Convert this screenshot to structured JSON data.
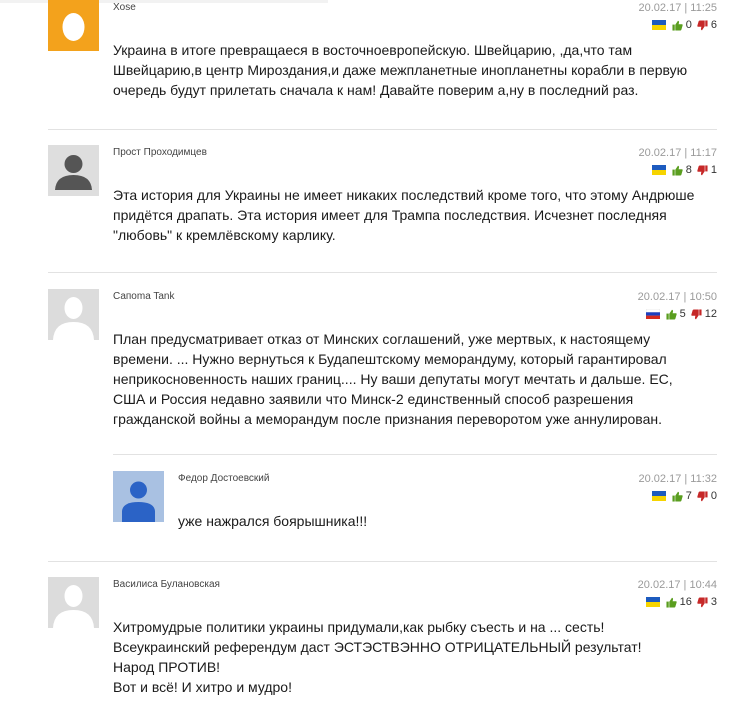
{
  "comments": [
    {
      "author": "Xose",
      "date": "20.02.17 | 11:25",
      "flag": "ukraine-flag",
      "avatar": "egg-avatar",
      "likes": "0",
      "dislikes": "6",
      "text": "Украина в итоге превращаеся в восточноевропейскую. Швейцарию, ,да,что там\nШвейцарию,в центр Мироздания,и даже межпланетные инопланетны корабли в первую\nочередь будут прилетать сначала к нам! Давайте поверим а,ну в последний раз."
    },
    {
      "author": "Прост Проходимцев",
      "date": "20.02.17 | 11:17",
      "flag": "ukraine-flag",
      "avatar": "default-user-avatar",
      "likes": "8",
      "dislikes": "1",
      "text": "Эта история для Украины не имеет никаких последствий кроме того, что этому Андрюше\nпридётся драпать. Эта история имеет для Трампа последствия. Исчезнет последняя\n\"любовь\" к кремлёвскому карлику."
    },
    {
      "author": "Сапоma Tank",
      "date": "20.02.17 | 10:50",
      "flag": "russia-flag",
      "avatar": "default-user-avatar-light",
      "likes": "5",
      "dislikes": "12",
      "text": "План предусматривает отказ от Минских соглашений, уже мертвых, к настоящему\nвремени. ... Нужно вернуться к Будапештскому меморандуму, который гарантировал\nнеприкосновенность наших границ.... Ну ваши депутаты могут мечтать и дальше. ЕС,\nСША и Россия недавно заявили что Минск-2 единственный способ разрешения\nгражданской войны а меморандум после признания переворотом уже аннулирован."
    },
    {
      "author": "Федор Достоевский",
      "date": "20.02.17 | 11:32",
      "flag": "ukraine-flag",
      "avatar": "blue-user-avatar",
      "likes": "7",
      "dislikes": "0",
      "text": "уже нажрался боярышника!!!"
    },
    {
      "author": "Василиса Булановская",
      "date": "20.02.17 | 10:44",
      "flag": "ukraine-flag",
      "avatar": "default-user-avatar-light",
      "likes": "16",
      "dislikes": "3",
      "text": "Хитромудрые политики украины придумали,как рыбку съесть и на ... сесть!\nВсеукраинский референдум даст ЭСТЭСТВЭННО ОТРИЦАТЕЛЬНЫЙ результат!\nНарод ПРОТИВ!\nВот и всё! И хитро и мудро!"
    }
  ],
  "colors": {
    "like": "#5a9e1f",
    "dislike": "#c62828",
    "divider": "#e2e2e2",
    "date": "#9a9a9a"
  }
}
